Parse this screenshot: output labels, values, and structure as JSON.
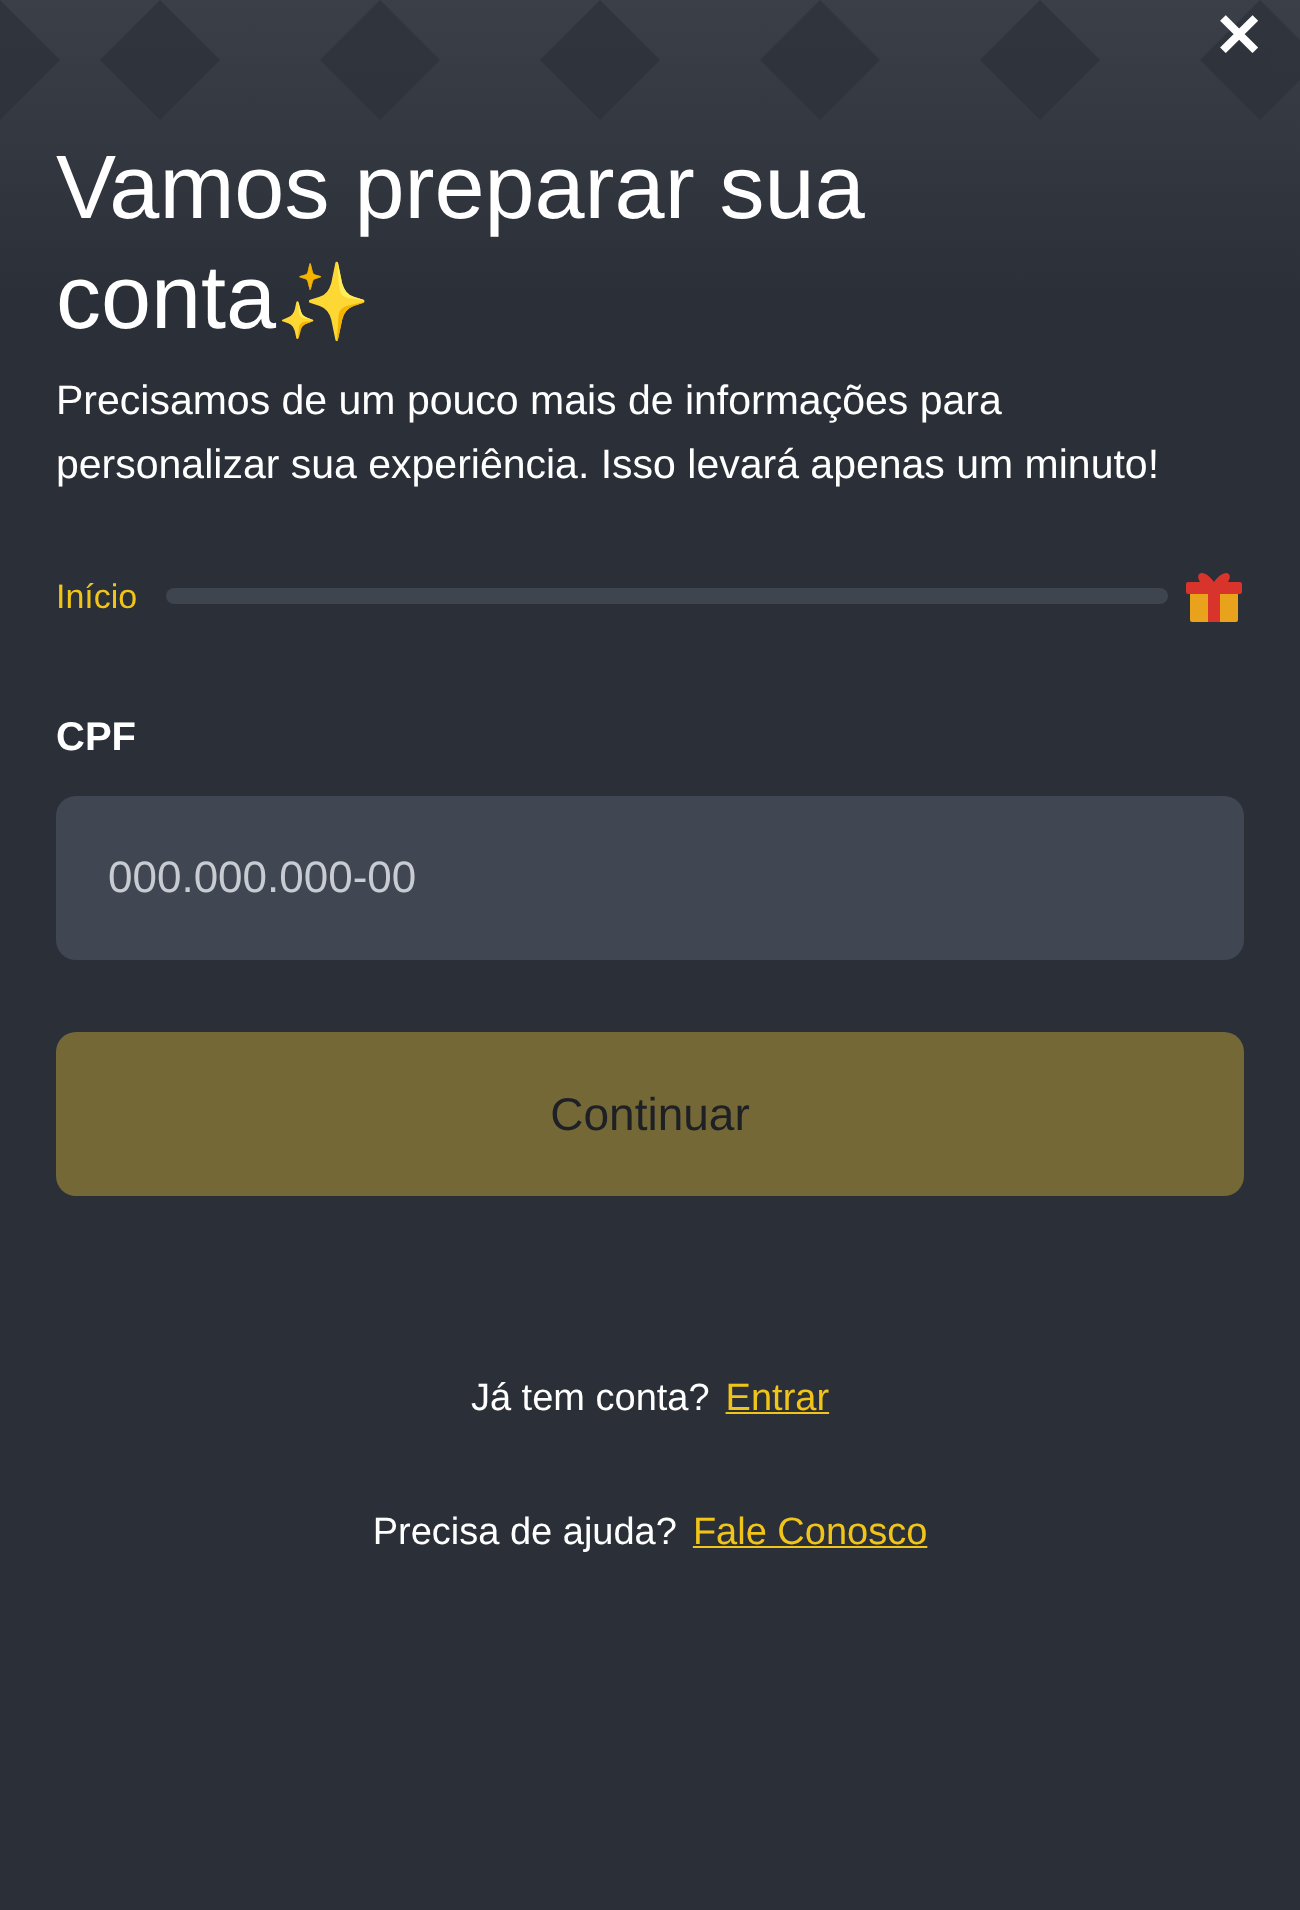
{
  "close_button": {
    "label": "✕"
  },
  "title": "Vamos preparar sua conta✨",
  "subtitle": "Precisamos de um pouco mais de informações para personalizar sua experiência. Isso levará apenas um minuto!",
  "progress": {
    "label": "Início"
  },
  "field": {
    "label": "CPF",
    "placeholder": "000.000.000-00"
  },
  "continue_button": {
    "label": "Continuar",
    "disabled": true
  },
  "footer_links": [
    {
      "text": "Já tem conta?",
      "link": "Entrar"
    },
    {
      "text": "Precisa de ajuda?",
      "link": "Fale Conosco"
    }
  ]
}
